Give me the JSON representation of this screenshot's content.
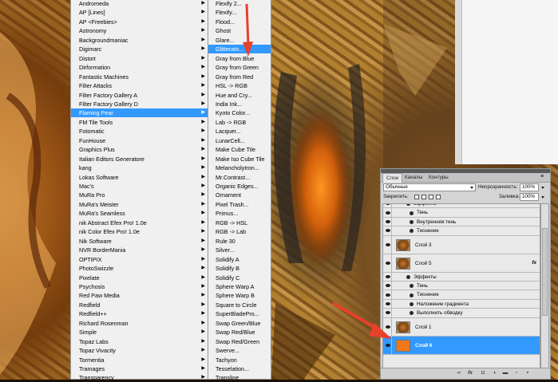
{
  "filters_menu": {
    "items": [
      {
        "label": "Andromeda",
        "sub": true
      },
      {
        "label": "AP [Lines]",
        "sub": true
      },
      {
        "label": "AP <Freebies>",
        "sub": true
      },
      {
        "label": "Astronomy",
        "sub": true
      },
      {
        "label": "Backgroundmaniac",
        "sub": true
      },
      {
        "label": "Digimarc",
        "sub": true
      },
      {
        "label": "Distort",
        "sub": true
      },
      {
        "label": "Dirformation",
        "sub": true
      },
      {
        "label": "Fantastic Machines",
        "sub": true
      },
      {
        "label": "Filter Attacks",
        "sub": true
      },
      {
        "label": "Filter Factory Gallery A",
        "sub": true
      },
      {
        "label": "Filter Factory Gallery D",
        "sub": true
      },
      {
        "label": "Flaming Pear",
        "sub": true,
        "highlighted": true
      },
      {
        "label": "FM Tile Tools",
        "sub": true
      },
      {
        "label": "Fotomatic",
        "sub": true
      },
      {
        "label": "FunHouse",
        "sub": true
      },
      {
        "label": "Graphics Plus",
        "sub": true
      },
      {
        "label": "Italian Editors Generatore",
        "sub": true
      },
      {
        "label": "kang",
        "sub": true
      },
      {
        "label": "Lokas Software",
        "sub": true
      },
      {
        "label": "Mac's",
        "sub": true
      },
      {
        "label": "MuRa Pro",
        "sub": true
      },
      {
        "label": "MuRa's Meister",
        "sub": true
      },
      {
        "label": "MuRa's Seamless",
        "sub": true
      },
      {
        "label": "nik Abstract Efex Pro! 1.0e",
        "sub": true
      },
      {
        "label": "nik Color Efex Pro! 1.0e",
        "sub": true
      },
      {
        "label": "Nik Software",
        "sub": true
      },
      {
        "label": "NVR BorderMania",
        "sub": true
      },
      {
        "label": "OPTIPIX",
        "sub": true
      },
      {
        "label": "PhotoSwizzle",
        "sub": true
      },
      {
        "label": "Pixelate",
        "sub": true
      },
      {
        "label": "Psychosis",
        "sub": true
      },
      {
        "label": "Red Paw Media",
        "sub": true
      },
      {
        "label": "Redfield",
        "sub": true
      },
      {
        "label": "Redfield++",
        "sub": true
      },
      {
        "label": "Richard Rosenman",
        "sub": true
      },
      {
        "label": "Simple",
        "sub": true
      },
      {
        "label": "Topaz Labs",
        "sub": true
      },
      {
        "label": "Topaz Vivacity",
        "sub": true
      },
      {
        "label": "Tormentia",
        "sub": true
      },
      {
        "label": "Tramages",
        "sub": true
      },
      {
        "label": "Transparency",
        "sub": true
      }
    ]
  },
  "flaming_pear_menu": {
    "items": [
      {
        "label": "Flexify 2..."
      },
      {
        "label": "Flexify..."
      },
      {
        "label": "Flood..."
      },
      {
        "label": "Ghost"
      },
      {
        "label": "Glare..."
      },
      {
        "label": "Glitterato...",
        "highlighted": true
      },
      {
        "label": "Gray from Blue"
      },
      {
        "label": "Gray from Green"
      },
      {
        "label": "Gray from Red"
      },
      {
        "label": "HSL -> RGB"
      },
      {
        "label": "Hue and Cry..."
      },
      {
        "label": "India Ink..."
      },
      {
        "label": "Kyoto Color..."
      },
      {
        "label": "Lab -> RGB"
      },
      {
        "label": "Lacquer..."
      },
      {
        "label": "LunarCell..."
      },
      {
        "label": "Make Cube Tile"
      },
      {
        "label": "Make Iso Cube Tile"
      },
      {
        "label": "Melancholytron..."
      },
      {
        "label": "Mr.Contrast..."
      },
      {
        "label": "Organic Edges..."
      },
      {
        "label": "Ornament"
      },
      {
        "label": "Pixel Trash..."
      },
      {
        "label": "Primus..."
      },
      {
        "label": "RGB -> HSL"
      },
      {
        "label": "RGB -> Lab"
      },
      {
        "label": "Rule 30"
      },
      {
        "label": "Silver..."
      },
      {
        "label": "Solidify A"
      },
      {
        "label": "Solidify B"
      },
      {
        "label": "Solidify C"
      },
      {
        "label": "Sphere Warp A"
      },
      {
        "label": "Sphere Warp B"
      },
      {
        "label": "Square to Circle"
      },
      {
        "label": "SuperBladePro..."
      },
      {
        "label": "Swap Green/Blue"
      },
      {
        "label": "Swap Red/Blue"
      },
      {
        "label": "Swap Red/Green"
      },
      {
        "label": "Swerve..."
      },
      {
        "label": "Tachyon"
      },
      {
        "label": "Tesselation..."
      },
      {
        "label": "Transline"
      }
    ]
  },
  "layers_panel": {
    "tabs": [
      "Слои",
      "Каналы",
      "Контуры"
    ],
    "blend_mode": "Обычные",
    "opacity_label": "Непрозрачность:",
    "opacity_value": "100%",
    "lock_label": "Закрепить:",
    "fill_label": "Заливка:",
    "fill_value": "100%",
    "rows": [
      {
        "kind": "fx",
        "label": "Эффекты"
      },
      {
        "kind": "effect",
        "label": "Тень"
      },
      {
        "kind": "effect",
        "label": "Внутренняя тень"
      },
      {
        "kind": "effect",
        "label": "Тиснение"
      },
      {
        "kind": "layer",
        "label": "Слой 3"
      },
      {
        "kind": "layer",
        "label": "Слой 5",
        "fx": "fx"
      },
      {
        "kind": "fx",
        "label": "Эффекты"
      },
      {
        "kind": "effect",
        "label": "Тень"
      },
      {
        "kind": "effect",
        "label": "Тиснение"
      },
      {
        "kind": "effect",
        "label": "Наложение градиента"
      },
      {
        "kind": "effect",
        "label": "Выполнить обводку"
      },
      {
        "kind": "layer",
        "label": "Слой 1"
      },
      {
        "kind": "layer",
        "label": "Слой 6",
        "selected": true
      }
    ]
  },
  "colors": {
    "menu_bg": "#f0f0f0",
    "highlight": "#3399ff",
    "arrow": "#e8402a",
    "layer6_thumb": "#f07818"
  }
}
